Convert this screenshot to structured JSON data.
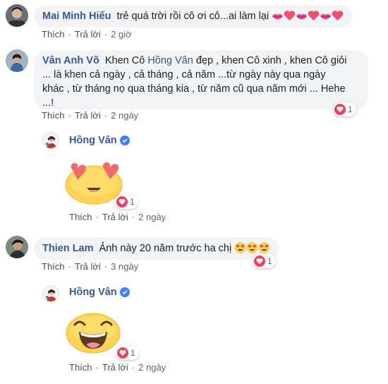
{
  "comments": [
    {
      "author": "Mai Minh Hiếu",
      "text": "trẻ quá trời rồi cô ơi cô...ai làm lại",
      "emoji_sequence": [
        "kiss-icon",
        "heart-icon",
        "kiss-icon",
        "heart-icon",
        "kiss-icon",
        "heart-icon"
      ],
      "like_label": "Thích",
      "reply_label": "Trả lời",
      "time": "2 giờ"
    },
    {
      "author": "Vân Anh Võ",
      "text_before": "Khen Cô",
      "mention": "Hồng Vân",
      "text_line1_after": "đẹp , khen Cô xinh , khen Cô giỏi",
      "text_line2": "... là khen cả ngày , cả tháng , cả năm ...từ ngày này qua ngày",
      "text_line3": "khác , từ tháng nọ qua tháng kia , từ năm cũ qua năm mới ... Hehe",
      "text_line4": "...!",
      "like_label": "Thích",
      "reply_label": "Trả lời",
      "time": "2 ngày",
      "reaction_count": "1"
    },
    {
      "author": "Hồng Vân",
      "sticker": "heart-eyes-sticker",
      "like_label": "Thích",
      "reply_label": "Trả lời",
      "time": "2 ngày",
      "reaction_count": "1"
    },
    {
      "author": "Thien Lam",
      "text": "Ảnh này 20 năm trước ha chị",
      "emoji_sequence": [
        "heart-eyes-icon",
        "heart-eyes-icon",
        "heart-eyes-icon"
      ],
      "like_label": "Thích",
      "reply_label": "Trả lời",
      "time": "3 ngày",
      "reaction_count": "1"
    },
    {
      "author": "Hồng Vân",
      "sticker": "laughing-sticker",
      "like_label": "Thích",
      "reply_label": "Trả lời",
      "time": "2 ngày",
      "reaction_count": "1"
    }
  ],
  "separator": "·",
  "colors": {
    "link": "#385898",
    "bubble": "#f2f3f5",
    "heart": "#f33e58",
    "verified": "#4080ff",
    "meta": "#606770"
  }
}
